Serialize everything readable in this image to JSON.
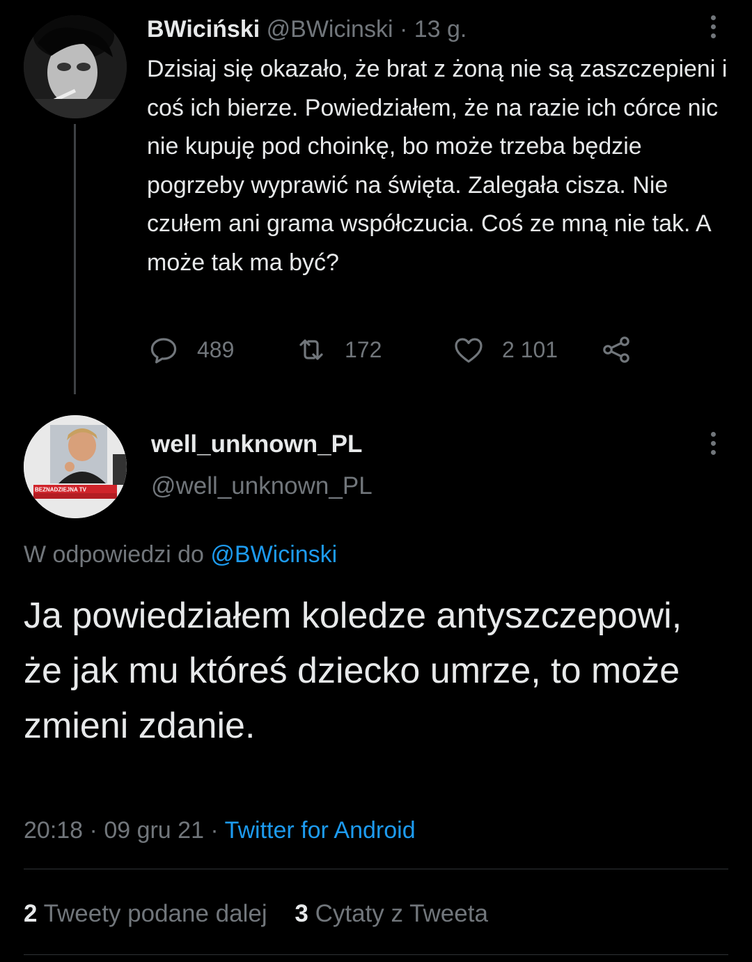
{
  "tweet": {
    "author_name": "BWiciński",
    "author_handle": "@BWicinski",
    "separator": " · ",
    "time": "13 g.",
    "text": "Dzisiaj się okazało, że brat z żoną nie są zaszczepieni i coś ich bierze. Powiedziałem, że na razie ich córce nic nie kupuję pod choinkę, bo może trzeba będzie pogrzeby wyprawić na święta. Zalegała cisza. Nie czułem ani grama współczucia. Coś ze mną nie tak. A może tak ma być?",
    "actions": {
      "replies": "489",
      "retweets": "172",
      "likes": "2 101"
    },
    "icons": [
      "reply-icon",
      "retweet-icon",
      "like-icon",
      "share-icon",
      "more-icon"
    ]
  },
  "reply": {
    "author_name": "well_unknown_PL",
    "author_handle": "@well_unknown_PL",
    "avatar_text": "BEZNADZIEJNA TV",
    "replying_to_label": "W odpowiedzi do ",
    "replying_to_handle": "@BWicinski",
    "text": "Ja powiedziałem koledze antyszczepowi, że jak mu któreś dziecko umrze, to może zmieni zdanie.",
    "time": "20:18",
    "date": "09 gru 21",
    "separator": " · ",
    "source": "Twitter for Android",
    "stats": {
      "retweets_count": "2",
      "retweets_label": "Tweety podane dalej",
      "quotes_count": "3",
      "quotes_label": "Cytaty z Tweeta"
    }
  },
  "colors": {
    "background": "#000000",
    "text": "#e7e9ea",
    "muted": "#71767b",
    "link": "#1d9bf0",
    "divider": "#2f3336"
  }
}
